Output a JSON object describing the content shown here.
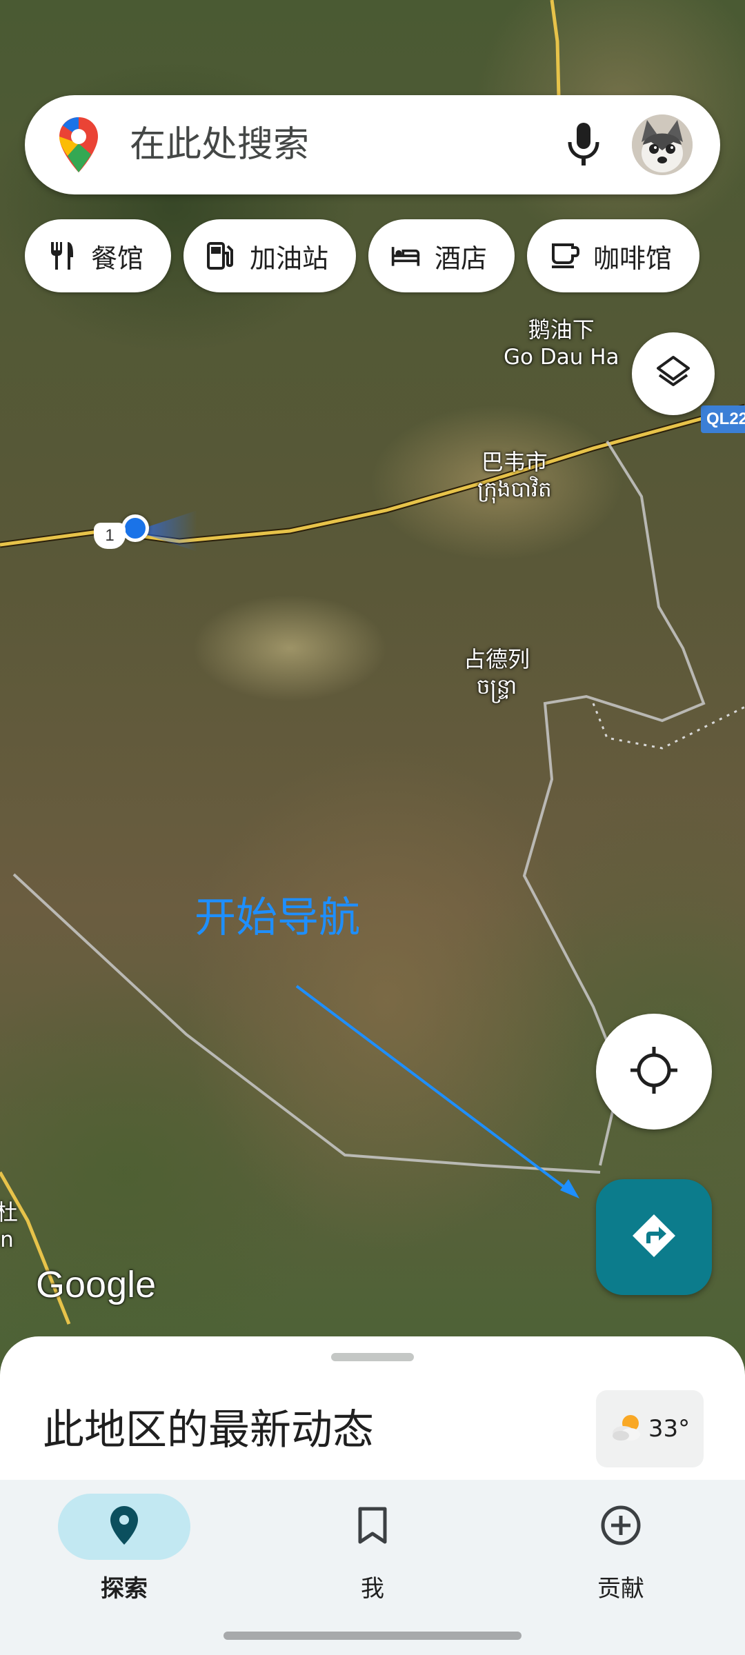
{
  "search": {
    "placeholder": "在此处搜索"
  },
  "chips": [
    {
      "label": "餐馆",
      "icon": "restaurant-icon"
    },
    {
      "label": "加油站",
      "icon": "gas-station-icon"
    },
    {
      "label": "酒店",
      "icon": "hotel-icon"
    },
    {
      "label": "咖啡馆",
      "icon": "cafe-icon"
    }
  ],
  "map": {
    "labels": {
      "go_dau_ha_cn": "鹅油下",
      "go_dau_ha_latin": "Go Dau Ha",
      "bavet_cn": "巴韦市",
      "bavet_khmer": "ក្រុងបាវិត",
      "chantrea_cn": "占德列",
      "chantrea_khmer": "ចន្ទ្រា",
      "edge_left_1": "杜",
      "edge_left_2": "n"
    },
    "route_shield": "QL22",
    "highway_shield": "1",
    "logo": "Google",
    "annotation": "开始导航"
  },
  "sheet": {
    "title": "此地区的最新动态",
    "weather_temp": "33°",
    "weather_icon": "partly-cloudy-icon"
  },
  "nav": {
    "items": [
      {
        "label": "探索",
        "icon": "pin-icon",
        "active": true
      },
      {
        "label": "我",
        "icon": "bookmark-icon",
        "active": false
      },
      {
        "label": "贡献",
        "icon": "add-circle-icon",
        "active": false
      }
    ]
  },
  "colors": {
    "accent_teal": "#0c7c8c",
    "nav_active_pill": "#c2e8f2",
    "location_dot": "#1a73e8",
    "annotation_blue": "#1e8fff"
  }
}
